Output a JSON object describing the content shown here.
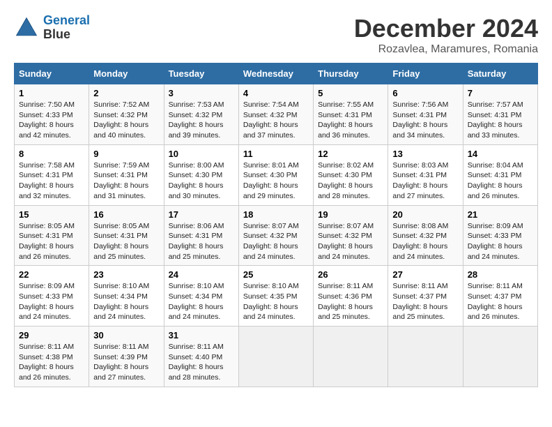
{
  "logo": {
    "line1": "General",
    "line2": "Blue"
  },
  "title": "December 2024",
  "subtitle": "Rozavlea, Maramures, Romania",
  "days_of_week": [
    "Sunday",
    "Monday",
    "Tuesday",
    "Wednesday",
    "Thursday",
    "Friday",
    "Saturday"
  ],
  "weeks": [
    [
      {
        "day": "1",
        "info": "Sunrise: 7:50 AM\nSunset: 4:33 PM\nDaylight: 8 hours\nand 42 minutes."
      },
      {
        "day": "2",
        "info": "Sunrise: 7:52 AM\nSunset: 4:32 PM\nDaylight: 8 hours\nand 40 minutes."
      },
      {
        "day": "3",
        "info": "Sunrise: 7:53 AM\nSunset: 4:32 PM\nDaylight: 8 hours\nand 39 minutes."
      },
      {
        "day": "4",
        "info": "Sunrise: 7:54 AM\nSunset: 4:32 PM\nDaylight: 8 hours\nand 37 minutes."
      },
      {
        "day": "5",
        "info": "Sunrise: 7:55 AM\nSunset: 4:31 PM\nDaylight: 8 hours\nand 36 minutes."
      },
      {
        "day": "6",
        "info": "Sunrise: 7:56 AM\nSunset: 4:31 PM\nDaylight: 8 hours\nand 34 minutes."
      },
      {
        "day": "7",
        "info": "Sunrise: 7:57 AM\nSunset: 4:31 PM\nDaylight: 8 hours\nand 33 minutes."
      }
    ],
    [
      {
        "day": "8",
        "info": "Sunrise: 7:58 AM\nSunset: 4:31 PM\nDaylight: 8 hours\nand 32 minutes."
      },
      {
        "day": "9",
        "info": "Sunrise: 7:59 AM\nSunset: 4:31 PM\nDaylight: 8 hours\nand 31 minutes."
      },
      {
        "day": "10",
        "info": "Sunrise: 8:00 AM\nSunset: 4:30 PM\nDaylight: 8 hours\nand 30 minutes."
      },
      {
        "day": "11",
        "info": "Sunrise: 8:01 AM\nSunset: 4:30 PM\nDaylight: 8 hours\nand 29 minutes."
      },
      {
        "day": "12",
        "info": "Sunrise: 8:02 AM\nSunset: 4:30 PM\nDaylight: 8 hours\nand 28 minutes."
      },
      {
        "day": "13",
        "info": "Sunrise: 8:03 AM\nSunset: 4:31 PM\nDaylight: 8 hours\nand 27 minutes."
      },
      {
        "day": "14",
        "info": "Sunrise: 8:04 AM\nSunset: 4:31 PM\nDaylight: 8 hours\nand 26 minutes."
      }
    ],
    [
      {
        "day": "15",
        "info": "Sunrise: 8:05 AM\nSunset: 4:31 PM\nDaylight: 8 hours\nand 26 minutes."
      },
      {
        "day": "16",
        "info": "Sunrise: 8:05 AM\nSunset: 4:31 PM\nDaylight: 8 hours\nand 25 minutes."
      },
      {
        "day": "17",
        "info": "Sunrise: 8:06 AM\nSunset: 4:31 PM\nDaylight: 8 hours\nand 25 minutes."
      },
      {
        "day": "18",
        "info": "Sunrise: 8:07 AM\nSunset: 4:32 PM\nDaylight: 8 hours\nand 24 minutes."
      },
      {
        "day": "19",
        "info": "Sunrise: 8:07 AM\nSunset: 4:32 PM\nDaylight: 8 hours\nand 24 minutes."
      },
      {
        "day": "20",
        "info": "Sunrise: 8:08 AM\nSunset: 4:32 PM\nDaylight: 8 hours\nand 24 minutes."
      },
      {
        "day": "21",
        "info": "Sunrise: 8:09 AM\nSunset: 4:33 PM\nDaylight: 8 hours\nand 24 minutes."
      }
    ],
    [
      {
        "day": "22",
        "info": "Sunrise: 8:09 AM\nSunset: 4:33 PM\nDaylight: 8 hours\nand 24 minutes."
      },
      {
        "day": "23",
        "info": "Sunrise: 8:10 AM\nSunset: 4:34 PM\nDaylight: 8 hours\nand 24 minutes."
      },
      {
        "day": "24",
        "info": "Sunrise: 8:10 AM\nSunset: 4:34 PM\nDaylight: 8 hours\nand 24 minutes."
      },
      {
        "day": "25",
        "info": "Sunrise: 8:10 AM\nSunset: 4:35 PM\nDaylight: 8 hours\nand 24 minutes."
      },
      {
        "day": "26",
        "info": "Sunrise: 8:11 AM\nSunset: 4:36 PM\nDaylight: 8 hours\nand 25 minutes."
      },
      {
        "day": "27",
        "info": "Sunrise: 8:11 AM\nSunset: 4:37 PM\nDaylight: 8 hours\nand 25 minutes."
      },
      {
        "day": "28",
        "info": "Sunrise: 8:11 AM\nSunset: 4:37 PM\nDaylight: 8 hours\nand 26 minutes."
      }
    ],
    [
      {
        "day": "29",
        "info": "Sunrise: 8:11 AM\nSunset: 4:38 PM\nDaylight: 8 hours\nand 26 minutes."
      },
      {
        "day": "30",
        "info": "Sunrise: 8:11 AM\nSunset: 4:39 PM\nDaylight: 8 hours\nand 27 minutes."
      },
      {
        "day": "31",
        "info": "Sunrise: 8:11 AM\nSunset: 4:40 PM\nDaylight: 8 hours\nand 28 minutes."
      },
      null,
      null,
      null,
      null
    ]
  ]
}
